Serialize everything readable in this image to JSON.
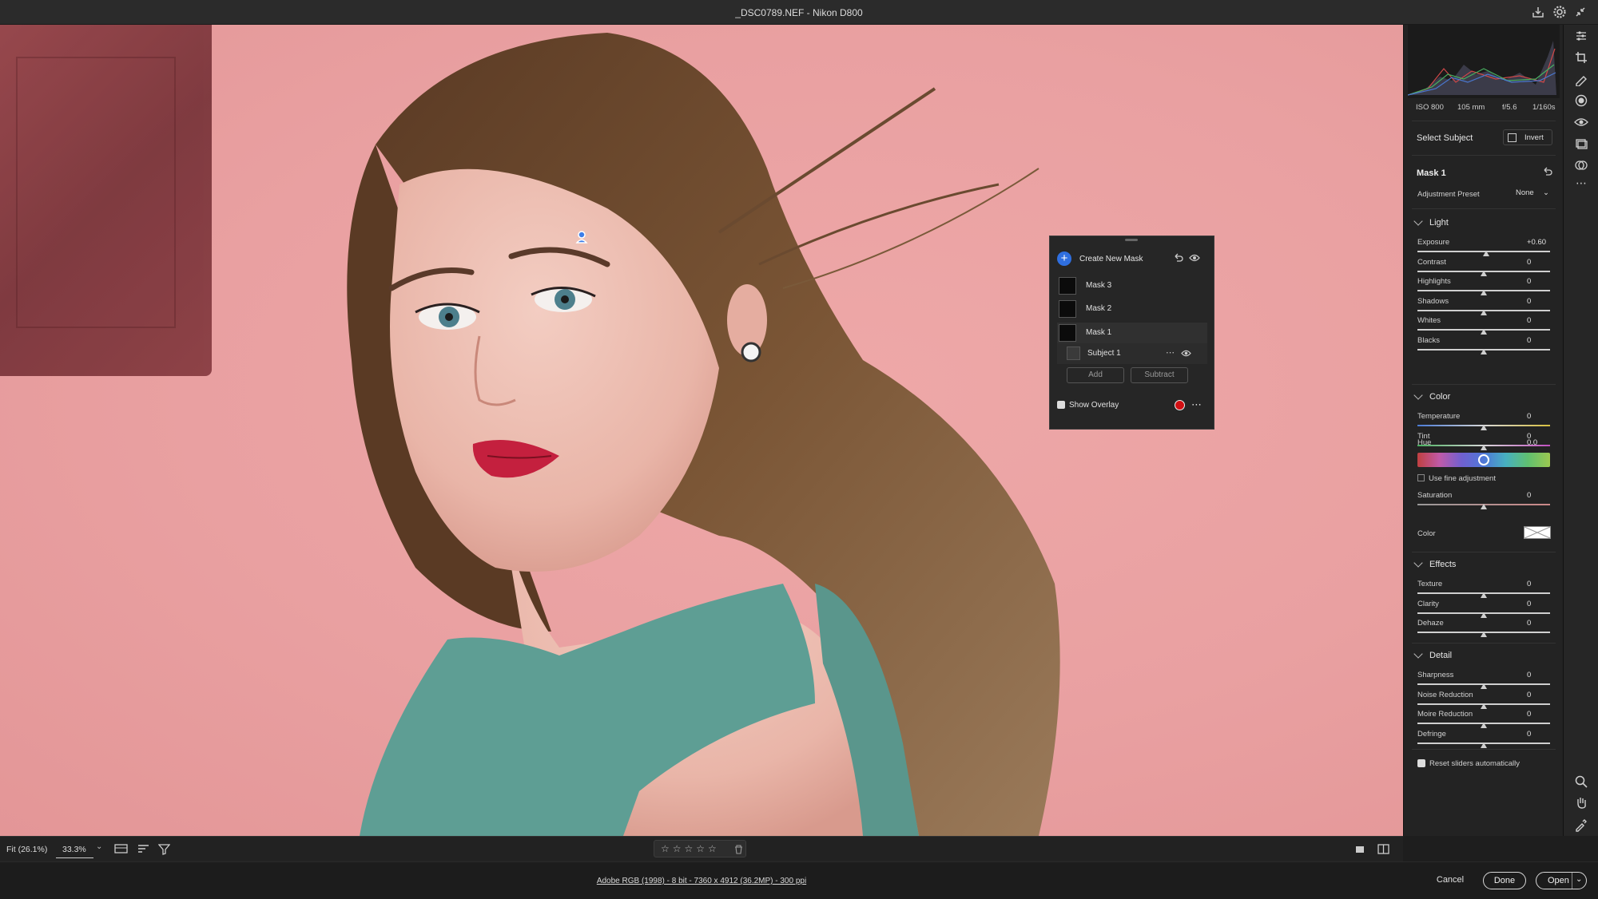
{
  "window": {
    "title": "_DSC0789.NEF  -  Nikon D800"
  },
  "camera": {
    "iso": "ISO 800",
    "focal": "105 mm",
    "aperture": "f/5.6",
    "shutter": "1/160s"
  },
  "select_subject": {
    "label": "Select Subject",
    "invert": "Invert"
  },
  "mask_header": {
    "title": "Mask 1",
    "preset_label": "Adjustment Preset",
    "preset_value": "None"
  },
  "mask_panel": {
    "create": "Create New Mask",
    "masks": [
      "Mask 3",
      "Mask 2",
      "Mask 1"
    ],
    "subject": "Subject 1",
    "add": "Add",
    "subtract": "Subtract",
    "show_overlay": "Show Overlay",
    "overlay_color": "#d10f13"
  },
  "sections": {
    "light": {
      "title": "Light",
      "sliders": [
        {
          "label": "Exposure",
          "value": "+0.60",
          "pos": 0.52
        },
        {
          "label": "Contrast",
          "value": "0",
          "pos": 0.5
        },
        {
          "label": "Highlights",
          "value": "0",
          "pos": 0.5
        },
        {
          "label": "Shadows",
          "value": "0",
          "pos": 0.5
        },
        {
          "label": "Whites",
          "value": "0",
          "pos": 0.5
        },
        {
          "label": "Blacks",
          "value": "0",
          "pos": 0.5
        }
      ]
    },
    "color": {
      "title": "Color",
      "temperature": {
        "label": "Temperature",
        "value": "0",
        "pos": 0.5
      },
      "tint": {
        "label": "Tint",
        "value": "0",
        "pos": 0.5
      },
      "hue": {
        "label": "Hue",
        "value": "0.0",
        "pos": 0.5
      },
      "fine": "Use fine adjustment",
      "saturation": {
        "label": "Saturation",
        "value": "0",
        "pos": 0.5
      },
      "color_label": "Color"
    },
    "effects": {
      "title": "Effects",
      "sliders": [
        {
          "label": "Texture",
          "value": "0",
          "pos": 0.5
        },
        {
          "label": "Clarity",
          "value": "0",
          "pos": 0.5
        },
        {
          "label": "Dehaze",
          "value": "0",
          "pos": 0.5
        }
      ]
    },
    "detail": {
      "title": "Detail",
      "sliders": [
        {
          "label": "Sharpness",
          "value": "0",
          "pos": 0.5
        },
        {
          "label": "Noise Reduction",
          "value": "0",
          "pos": 0.5
        },
        {
          "label": "Moire Reduction",
          "value": "0",
          "pos": 0.5
        },
        {
          "label": "Defringe",
          "value": "0",
          "pos": 0.5
        }
      ]
    }
  },
  "reset_auto": "Reset sliders automatically",
  "bottom": {
    "fit": "Fit (26.1%)",
    "zoom": "33.3%"
  },
  "footer": {
    "info": "Adobe RGB (1998) - 8 bit - 7360 x 4912 (36.2MP) - 300 ppi",
    "cancel": "Cancel",
    "done": "Done",
    "open": "Open"
  },
  "colors": {
    "accent": "#2f6fe0",
    "panel": "#232323"
  }
}
